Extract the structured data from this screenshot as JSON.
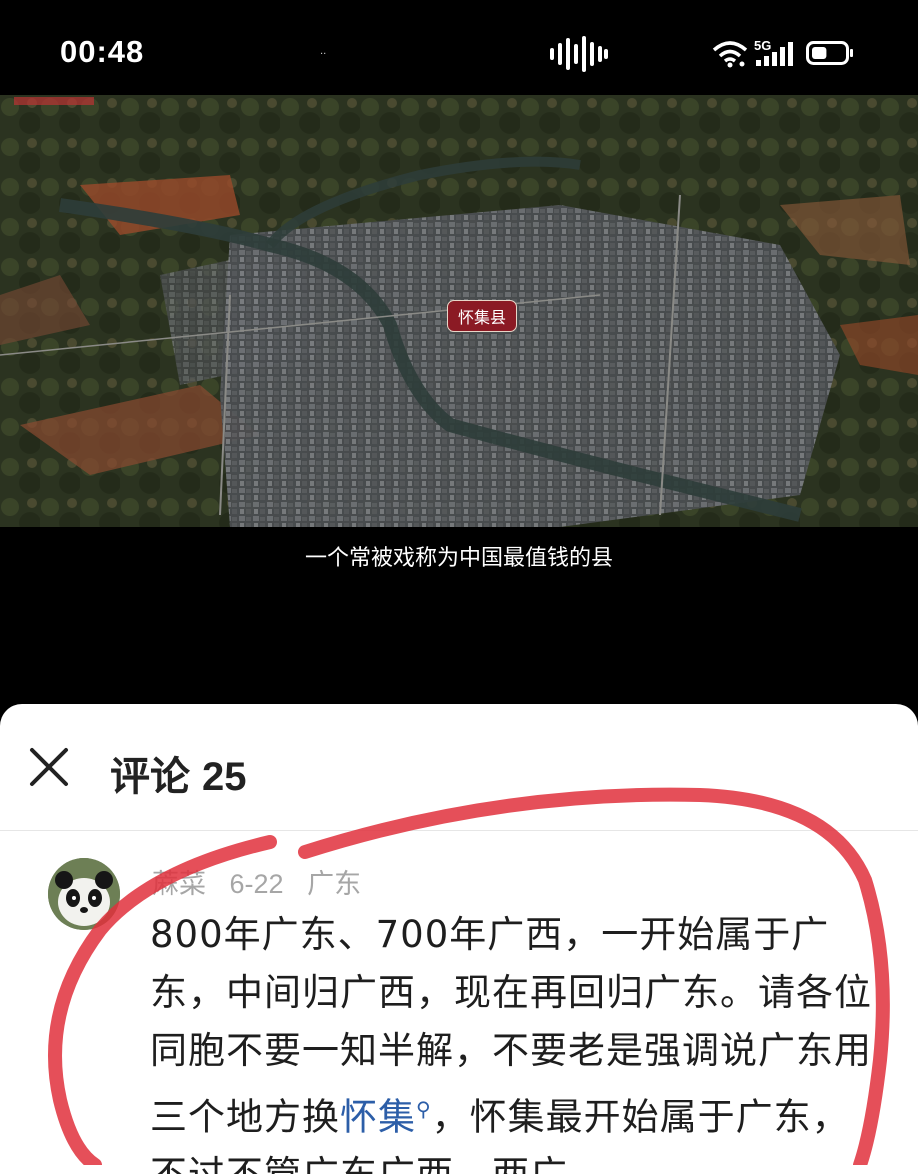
{
  "status_bar": {
    "time": "00:48",
    "network": "5G",
    "tiny_text": "..",
    "battery_level": 0.45
  },
  "video": {
    "map_label": "怀集县",
    "caption": "一个常被戏称为中国最值钱的县"
  },
  "comments_panel": {
    "title": "评论",
    "count": "25",
    "comment": {
      "author": "蔴菜",
      "date": "6-22",
      "location": "广东",
      "text_part1": "800年广东、700年广西，一开始属于广东，中间归广西，现在再回归广东。请各位同胞不要一知半解，不要老是强调说广东用三个地方换",
      "keyword": "怀集",
      "text_part2": "，怀集最开始属于广东，不过不管广东广西，两广"
    }
  },
  "colors": {
    "annotation_red": "#e0303c",
    "keyword_blue": "#2c5ea8",
    "label_red": "#8b1a24"
  }
}
